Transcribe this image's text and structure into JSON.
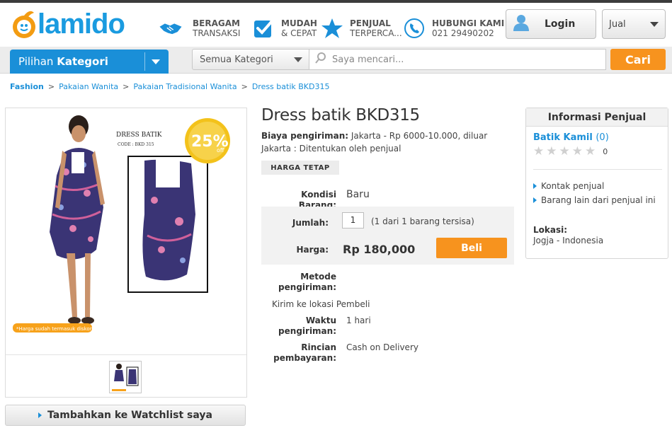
{
  "header": {
    "logo_text": "lamido",
    "features": [
      {
        "icon": "handshake-icon",
        "line1": "BERAGAM",
        "line2": "TRANSAKSI"
      },
      {
        "icon": "checkbox-icon",
        "line1": "MUDAH",
        "line2": "& CEPAT"
      },
      {
        "icon": "star-icon",
        "line1": "PENJUAL",
        "line2": "TERPERCA..."
      },
      {
        "icon": "phone-icon",
        "line1": "HUBUNGI KAMI",
        "line2": "021 29490202"
      }
    ],
    "login_label": "Login",
    "jual_label": "Jual"
  },
  "nav": {
    "kategori_prefix": "Pilihan",
    "kategori_strong": "Kategori",
    "category_select": "Semua Kategori",
    "search_placeholder": "Saya mencari...",
    "search_button": "Cari"
  },
  "breadcrumb": [
    "Fashion",
    "Pakaian Wanita",
    "Pakaian Tradisional Wanita",
    "Dress batik BKD315"
  ],
  "product": {
    "image_text": {
      "heading": "DRESS BATIK",
      "code": "CODE : BKD 315",
      "badge_pct": "25%",
      "badge_off": "off",
      "note": "*Harga sudah termasuk diskon"
    },
    "title": "Dress batik BKD315",
    "shipping_label": "Biaya pengiriman:",
    "shipping_text": "Jakarta - Rp 6000-10.000, diluar Jakarta : Ditentukan oleh penjual",
    "fixed_price_badge": "HARGA TETAP",
    "condition_label": "Kondisi Barang:",
    "condition_value": "Baru",
    "qty_label": "Jumlah:",
    "qty_value": "1",
    "qty_note": "(1 dari 1 barang tersisa)",
    "price_label": "Harga:",
    "price_value": "Rp  180,000",
    "buy_button": "Beli",
    "ship_method_label_1": "Metode",
    "ship_method_label_2": "pengiriman:",
    "ship_method_value": "Kirim ke lokasi Pembeli",
    "ship_time_label_1": "Waktu",
    "ship_time_label_2": "pengiriman:",
    "ship_time_value": "1 hari",
    "payment_label_1": "Rincian",
    "payment_label_2": "pembayaran:",
    "payment_value": "Cash on Delivery",
    "watchlist_button": "Tambahkan ke Watchlist saya"
  },
  "seller": {
    "panel_title": "Informasi Penjual",
    "name": "Batik Kamil",
    "feedback": "(0)",
    "rating_stars": 0,
    "rating_count": "0",
    "link_contact": "Kontak penjual",
    "link_other": "Barang lain dari penjual ini",
    "location_label": "Lokasi:",
    "location_value": "Jogja - Indonesia"
  },
  "colors": {
    "brand_blue": "#1a8fd8",
    "accent_orange": "#f7931e",
    "text_dark": "#333333"
  }
}
